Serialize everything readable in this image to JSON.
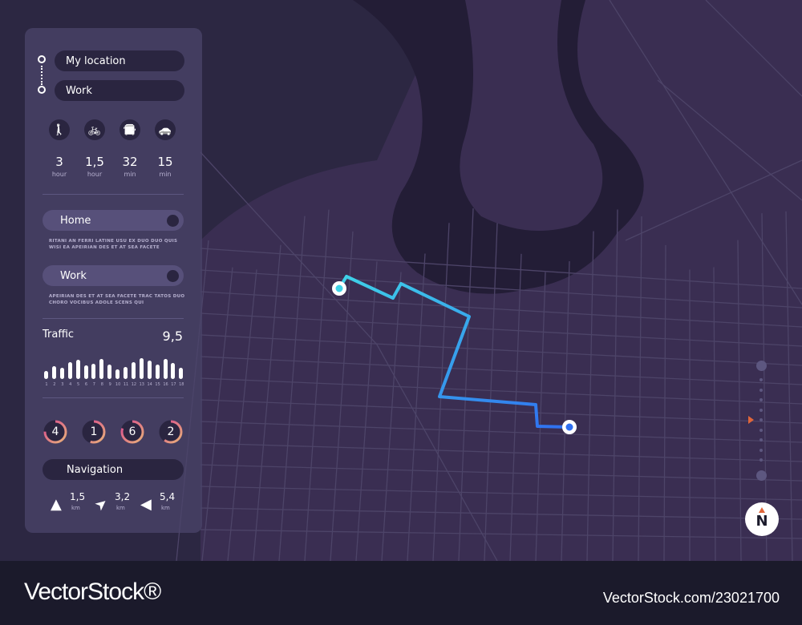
{
  "route": {
    "from": "My location",
    "to": "Work"
  },
  "modes": [
    {
      "icon": "walk-icon",
      "glyph": "🚶",
      "value": "3",
      "unit": "hour"
    },
    {
      "icon": "bicycle-icon",
      "glyph": "🚲",
      "value": "1,5",
      "unit": "hour"
    },
    {
      "icon": "bus-icon",
      "glyph": "🚍",
      "value": "32",
      "unit": "min"
    },
    {
      "icon": "car-icon",
      "glyph": "🚗",
      "value": "15",
      "unit": "min"
    }
  ],
  "places": [
    {
      "label": "Home",
      "description": "RITANI AN FERRI LATINE USU EX DUO DUO QUIS WISI EA APEIRIAN DES ET AT SEA FACETE"
    },
    {
      "label": "Work",
      "description": "APEIRIAN DES ET AT SEA FACETE TRAC TATOS DUO CHORO VOCIBUS ADOLE SCENS QUI"
    }
  ],
  "traffic": {
    "label": "Traffic",
    "value": "9,5",
    "hours": [
      "1",
      "2",
      "3",
      "4",
      "5",
      "6",
      "7",
      "8",
      "9",
      "10",
      "11",
      "12",
      "13",
      "14",
      "15",
      "16",
      "17",
      "18"
    ],
    "levels": [
      0.4,
      0.6,
      0.53,
      0.8,
      0.93,
      0.67,
      0.73,
      0.96,
      0.69,
      0.47,
      0.56,
      0.8,
      1.0,
      0.87,
      0.69,
      0.96,
      0.77,
      0.53
    ]
  },
  "rings": [
    {
      "value": "4",
      "fill": 0.75
    },
    {
      "value": "1",
      "fill": 0.55
    },
    {
      "value": "6",
      "fill": 0.8
    },
    {
      "value": "2",
      "fill": 0.6
    }
  ],
  "navigation": {
    "label": "Navigation",
    "items": [
      {
        "icon": "arrow-up-icon",
        "glyph": "▲",
        "distance": "1,5",
        "unit": "km"
      },
      {
        "icon": "arrow-up-right-icon",
        "glyph": "➤",
        "distance": "3,2",
        "unit": "km"
      },
      {
        "icon": "arrow-left-icon",
        "glyph": "◀",
        "distance": "5,4",
        "unit": "km"
      }
    ]
  },
  "compass": "N",
  "colors": {
    "route_start": "#3fd3e8",
    "route_end": "#2f6ff0",
    "ring_start": "#e8b27a",
    "ring_end": "#d9488f",
    "panel": "#4a4469"
  },
  "footer": {
    "logo": "VectorStock®",
    "id": "VectorStock.com/23021700"
  }
}
